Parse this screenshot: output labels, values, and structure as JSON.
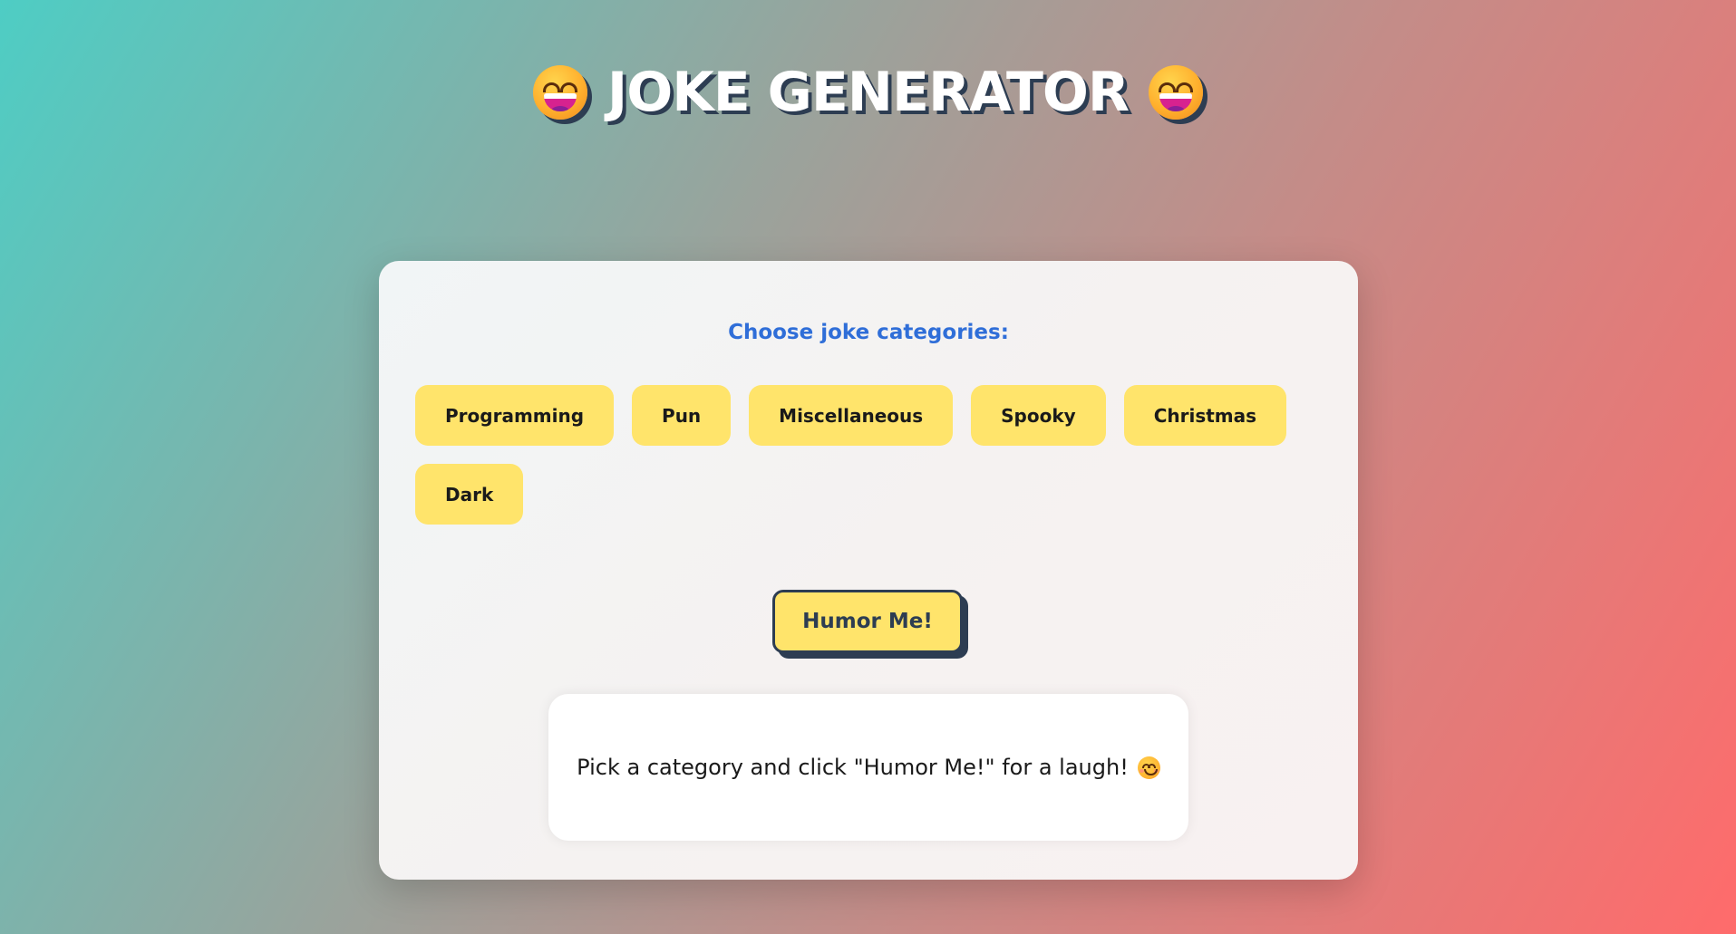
{
  "header": {
    "title": "JOKE GENERATOR",
    "left_icon": "grinning-face-icon",
    "right_icon": "grinning-face-icon"
  },
  "card": {
    "subtitle": "Choose joke categories:",
    "categories": [
      {
        "label": "Programming"
      },
      {
        "label": "Pun"
      },
      {
        "label": "Miscellaneous"
      },
      {
        "label": "Spooky"
      },
      {
        "label": "Christmas"
      },
      {
        "label": "Dark"
      }
    ],
    "action_button": "Humor Me!",
    "joke_text": "Pick a category and click \"Humor Me!\" for a laugh!",
    "joke_icon": "smiling-face-icon"
  },
  "colors": {
    "gradient_start": "#4ecdc4",
    "gradient_end": "#ff6b6b",
    "chip": "#ffe46b",
    "accent_text": "#2f6ed8",
    "dark": "#2d3d52"
  }
}
